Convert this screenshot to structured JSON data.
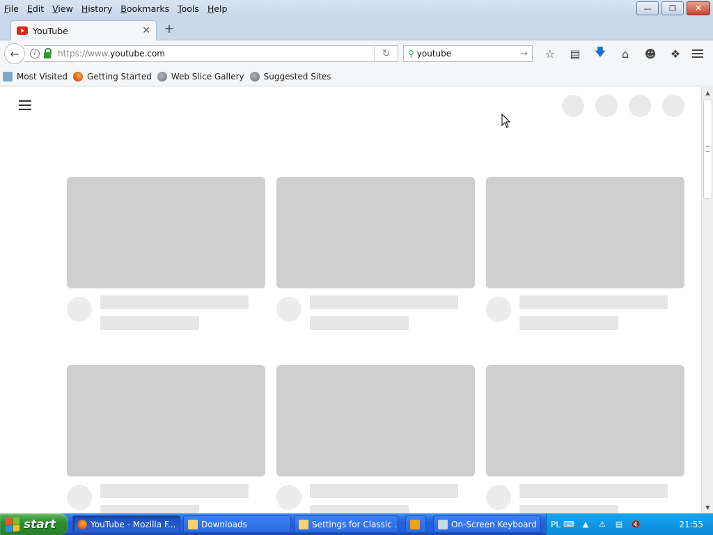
{
  "menu": [
    "File",
    "Edit",
    "View",
    "History",
    "Bookmarks",
    "Tools",
    "Help"
  ],
  "tab": {
    "title": "YouTube"
  },
  "url": {
    "prefix": "https://www.",
    "host": "youtube.com"
  },
  "search": {
    "value": "youtube"
  },
  "bookmarks": [
    "Most Visited",
    "Getting Started",
    "Web Slice Gallery",
    "Suggested Sites"
  ],
  "taskbar": {
    "start_label": "start",
    "tasks": [
      "YouTube - Mozilla F...",
      "Downloads",
      "Settings for Classic ...",
      "On-Screen Keyboard"
    ],
    "language": "PL",
    "clock": "21:55"
  },
  "colors": {
    "skeleton_thumb": "#cfcfcf",
    "skeleton_line": "#e6e6e6",
    "youtube_red": "#e62117",
    "taskbar_blue": "#245edb",
    "start_green": "#2f8f2f"
  }
}
